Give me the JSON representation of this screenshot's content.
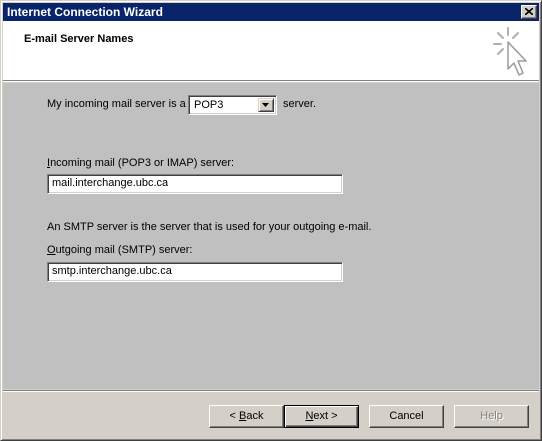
{
  "window": {
    "title": "Internet Connection Wizard",
    "close_icon": "close-x-icon"
  },
  "header": {
    "title": "E-mail Server Names",
    "icon": "wizard-cursor-icon"
  },
  "form": {
    "incoming_type_prefix": "My incoming mail server is a",
    "incoming_type_value": "POP3",
    "incoming_type_suffix": "server.",
    "incoming_label": "Incoming mail (POP3 or IMAP) server:",
    "incoming_value": "mail.interchange.ubc.ca",
    "smtp_note": "An SMTP server is the server that is used for your outgoing e-mail.",
    "outgoing_label": "Outgoing mail (SMTP) server:",
    "outgoing_value": "smtp.interchange.ubc.ca"
  },
  "buttons": {
    "back_prefix": "< ",
    "back_accel": "B",
    "back_rest": "ack",
    "next_accel": "N",
    "next_rest": "ext >",
    "cancel": "Cancel",
    "help": "Help"
  },
  "colors": {
    "titlebar": "#0a246a",
    "body": "#c0c0c0",
    "face": "#d4d0c8"
  }
}
